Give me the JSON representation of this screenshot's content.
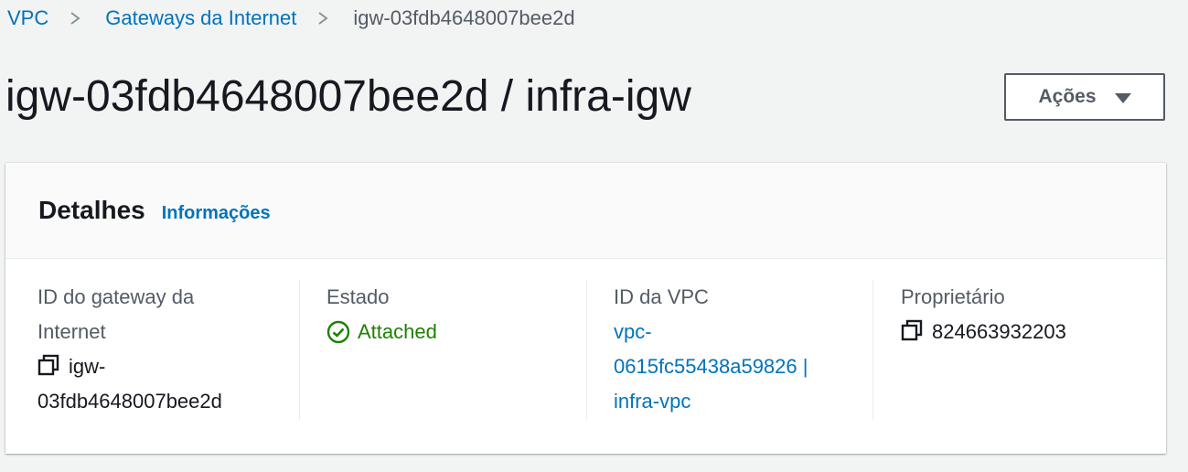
{
  "breadcrumb": {
    "items": [
      {
        "label": "VPC"
      },
      {
        "label": "Gateways da Internet"
      },
      {
        "label": "igw-03fdb4648007bee2d"
      }
    ]
  },
  "header": {
    "title": "igw-03fdb4648007bee2d / infra-igw",
    "actions_label": "Ações"
  },
  "details": {
    "title": "Detalhes",
    "info_link": "Informações",
    "columns": [
      {
        "label_line1": "ID do gateway da",
        "label_line2": "Internet",
        "value_line1": "igw-",
        "value_line2": "03fdb4648007bee2d",
        "icon": "copy-icon"
      },
      {
        "label": "Estado",
        "value": "Attached",
        "icon": "check-circle-icon"
      },
      {
        "label": "ID da VPC",
        "value_line1": "vpc-",
        "value_line2": "0615fc55438a59826 |",
        "value_line3": "infra-vpc"
      },
      {
        "label": "Proprietário",
        "value": "824663932203",
        "icon": "copy-icon"
      }
    ]
  },
  "colors": {
    "link": "#0073bb",
    "success": "#1d8102",
    "background": "#f2f3f3",
    "text": "#16191f",
    "secondary_text": "#545b64"
  }
}
